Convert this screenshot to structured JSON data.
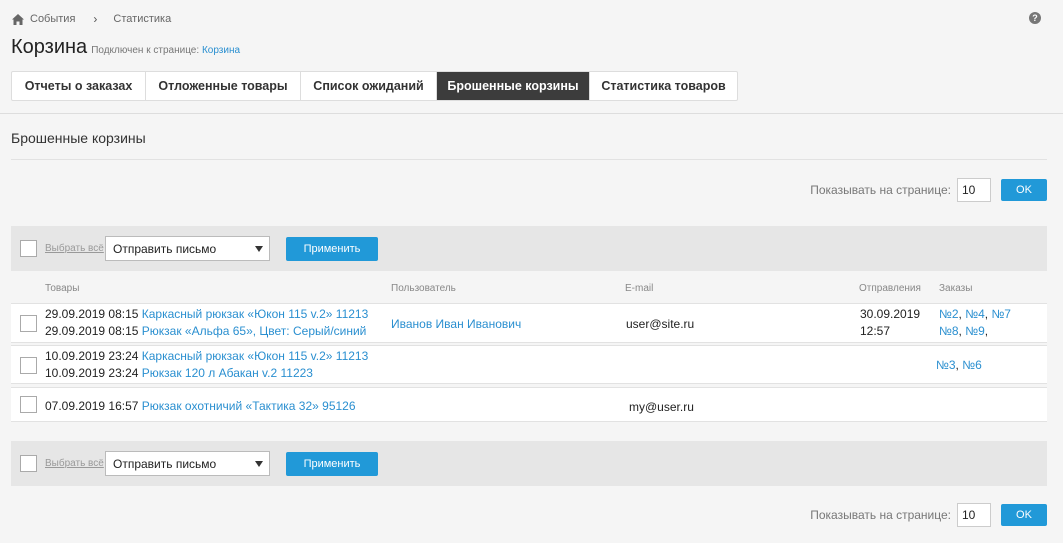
{
  "breadcrumb": {
    "home": "События",
    "current": "Статистика"
  },
  "page": {
    "title": "Корзина",
    "connected_prefix": "Подключен к странице:",
    "connected_link": "Корзина"
  },
  "tabs": [
    {
      "label": "Отчеты о заказах",
      "active": false
    },
    {
      "label": "Отложенные товары",
      "active": false
    },
    {
      "label": "Список ожиданий",
      "active": false
    },
    {
      "label": "Брошенные корзины",
      "active": true
    },
    {
      "label": "Статистика товаров",
      "active": false
    }
  ],
  "section_title": "Брошенные корзины",
  "pager": {
    "label": "Показывать на странице:",
    "value": "10",
    "ok_label": "OK"
  },
  "actions": {
    "select_all": "Выбрать всё",
    "action_value": "Отправить письмо",
    "apply_label": "Применить"
  },
  "columns": {
    "goods": "Товары",
    "user": "Пользователь",
    "email": "E-mail",
    "sent": "Отправления",
    "orders": "Заказы"
  },
  "rows": [
    {
      "items": [
        {
          "date": "29.09.2019 08:15",
          "name": "Каркасный рюкзак «Юкон 115 v.2» 11213"
        },
        {
          "date": "29.09.2019 08:15",
          "name": "Рюкзак «Альфа 65», Цвет: Серый/синий"
        }
      ],
      "user": "Иванов Иван Иванович",
      "email": "user@site.ru",
      "sent_date": "30.09.2019",
      "sent_time": "12:57",
      "orders_line1": [
        "№2",
        "№4",
        "№7"
      ],
      "orders_line2": [
        "№8",
        "№9"
      ]
    },
    {
      "items": [
        {
          "date": "10.09.2019 23:24",
          "name": "Каркасный рюкзак «Юкон 115 v.2» 11213"
        },
        {
          "date": "10.09.2019 23:24",
          "name": "Рюкзак 120 л Абакан v.2 11223"
        }
      ],
      "user": "",
      "email": "",
      "orders_line1": [
        "№3",
        "№6"
      ]
    },
    {
      "items": [
        {
          "date": "07.09.2019 16:57",
          "name": "Рюкзак охотничий «Тактика 32» 95126"
        }
      ],
      "user": "",
      "email": "my@user.ru"
    }
  ]
}
